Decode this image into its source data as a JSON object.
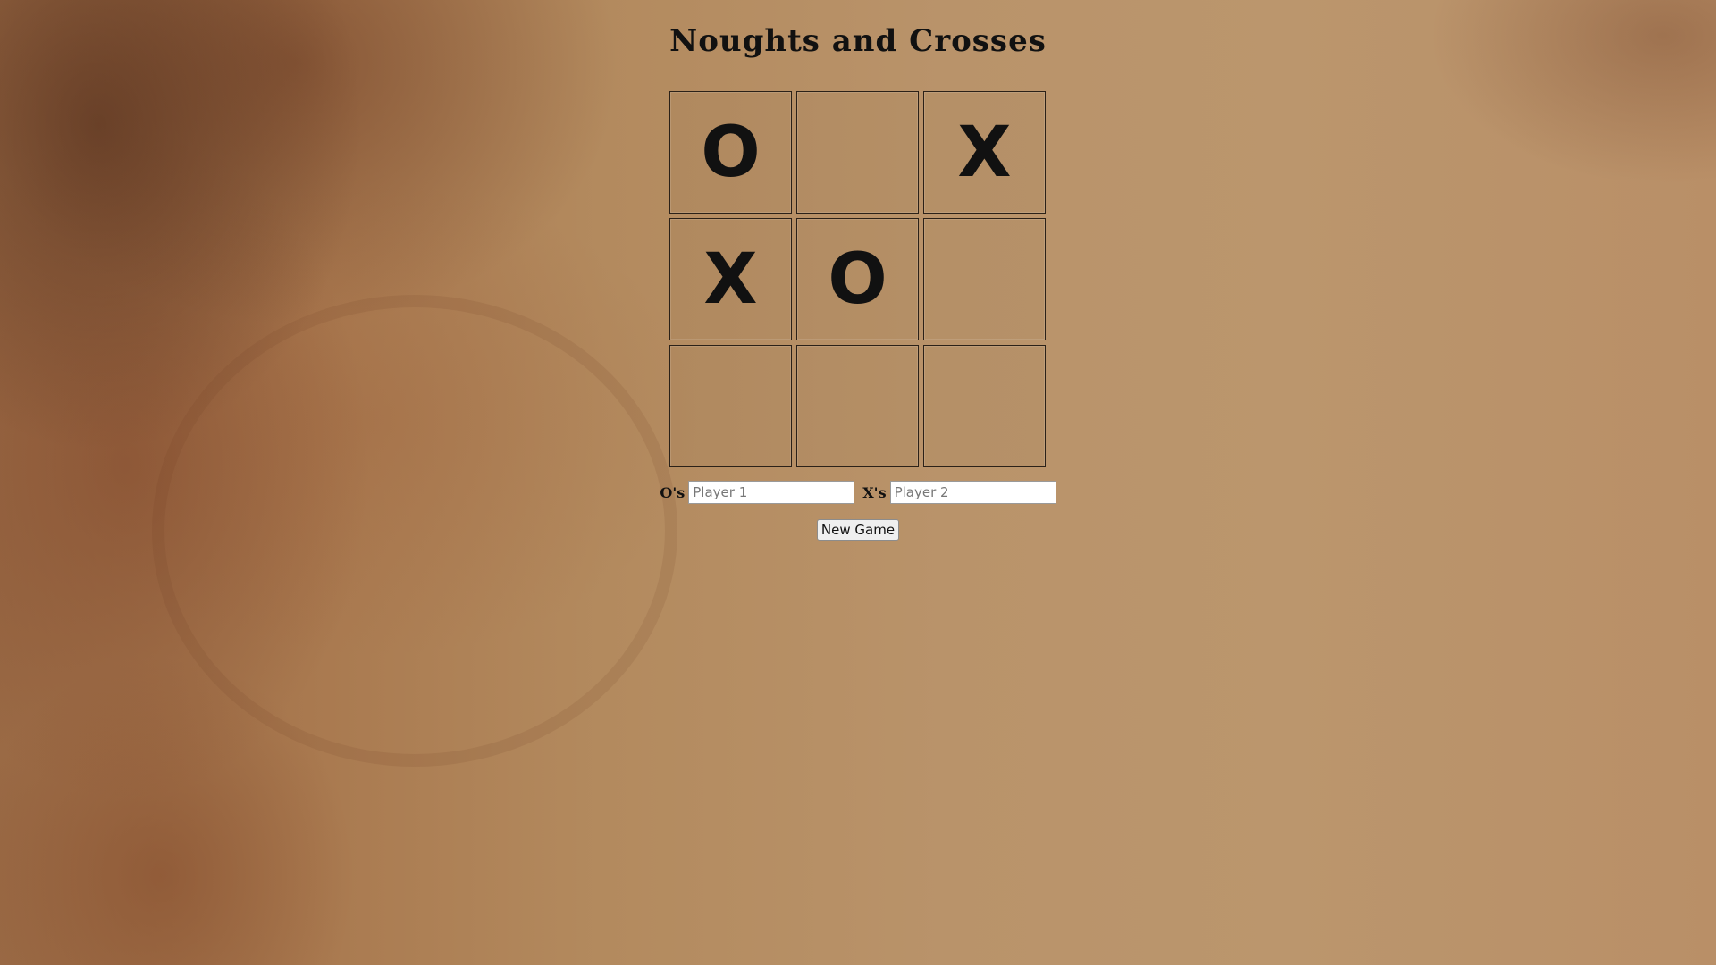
{
  "page": {
    "title": "Noughts and Crosses"
  },
  "board": {
    "cells": [
      "O",
      "",
      "X",
      "X",
      "O",
      "",
      "",
      "",
      ""
    ]
  },
  "players": {
    "noughts_label": "O's",
    "noughts_placeholder": "Player 1",
    "crosses_label": "X's",
    "crosses_placeholder": "Player 2"
  },
  "controls": {
    "new_game_label": "New Game"
  },
  "icons": {
    "nought": "O",
    "cross": "X"
  }
}
